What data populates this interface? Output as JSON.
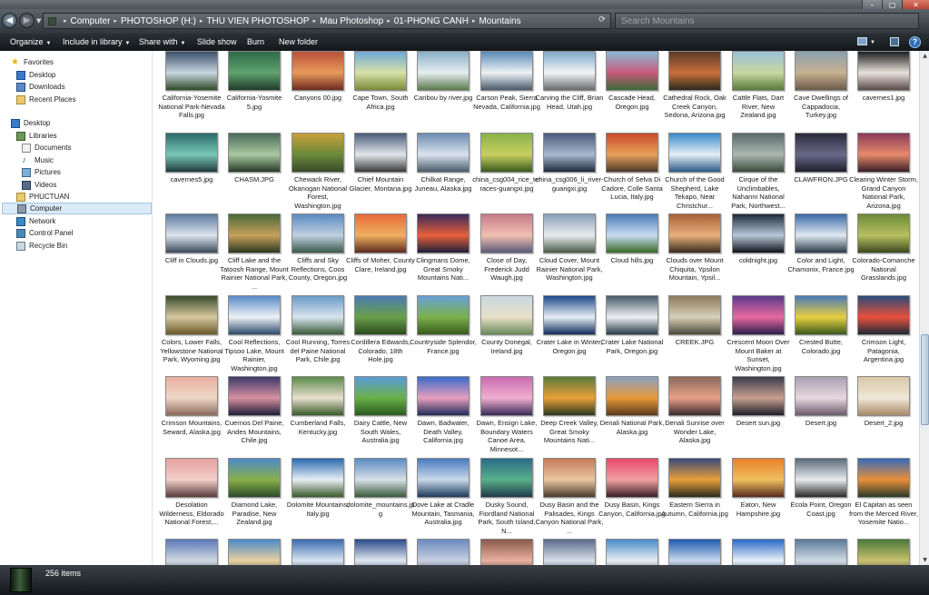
{
  "window": {
    "controls": [
      "–",
      "▢",
      "✕"
    ]
  },
  "address": {
    "crumbs": [
      "Computer",
      "PHOTOSHOP (H:)",
      "THU VIEN PHOTOSHOP",
      "Mau Photoshop",
      "01-PHONG CANH",
      "Mountains"
    ],
    "separator": "▸",
    "search_placeholder": "Search Mountains"
  },
  "toolbar": {
    "organize": "Organize",
    "include": "Include in library",
    "share": "Share with",
    "slideshow": "Slide show",
    "burn": "Burn",
    "newfolder": "New folder",
    "help": "?"
  },
  "nav": {
    "favorites": "Favorites",
    "desktop_fav": "Desktop",
    "downloads": "Downloads",
    "recent": "Recent Places",
    "desktop": "Desktop",
    "libraries": "Libraries",
    "documents": "Documents",
    "music": "Music",
    "pictures": "Pictures",
    "videos": "Videos",
    "user": "PHUCTUAN",
    "computer": "Computer",
    "network": "Network",
    "control_panel": "Control Panel",
    "recycle": "Recycle Bin"
  },
  "files": [
    {
      "name": "California-Yosemite National Park-Nevada Falls.jpg",
      "c1": "#3a4f6b",
      "c2": "#c8d6e0",
      "c3": "#2f4a2a"
    },
    {
      "name": "California-Yosmite 5.jpg",
      "c1": "#2f6b4a",
      "c2": "#5fa26e",
      "c3": "#1f3d2a"
    },
    {
      "name": "Canyons 00.jpg",
      "c1": "#b8523a",
      "c2": "#e89a5a",
      "c3": "#6b2a1e"
    },
    {
      "name": "Cape Town, South Africa.jpg",
      "c1": "#6ea8d6",
      "c2": "#d8e2a8",
      "c3": "#7a8a3a"
    },
    {
      "name": "Caribou by river.jpg",
      "c1": "#8ab0c8",
      "c2": "#e6eef2",
      "c3": "#5a7a4a"
    },
    {
      "name": "Carson Peak, Sierra Nevada, California.jpg",
      "c1": "#5a8ab8",
      "c2": "#eef2f5",
      "c3": "#4a5a6a"
    },
    {
      "name": "Carving the Cliff, Brian Head, Utah.jpg",
      "c1": "#7fa8c8",
      "c2": "#f2f4f6",
      "c3": "#6a6a6a"
    },
    {
      "name": "Cascade Head, Oregon.jpg",
      "c1": "#8ab8d8",
      "c2": "#c85a7a",
      "c3": "#3a6a3a"
    },
    {
      "name": "Cathedral Rock, Oak Creek Canyon, Sedona, Arizona.jpg",
      "c1": "#5a3a2a",
      "c2": "#c8703a",
      "c3": "#2a2a1e"
    },
    {
      "name": "Cattle Flats, Dart River, New Zealand.jpg",
      "c1": "#9ac0d8",
      "c2": "#c8d8a0",
      "c3": "#5a7a3a"
    },
    {
      "name": "Cave Dwellings of Cappadocia, Turkey.jpg",
      "c1": "#8aa0b0",
      "c2": "#c8b090",
      "c3": "#6a5a4a"
    },
    {
      "name": "cavernes1.jpg",
      "c1": "#1e1e1e",
      "c2": "#e8e2dc",
      "c3": "#5a4a4a"
    },
    {
      "name": "cavernes5.jpg",
      "c1": "#2a6a6a",
      "c2": "#7ac8b8",
      "c3": "#1e3a3a"
    },
    {
      "name": "CHASM.JPG",
      "c1": "#4a6a5a",
      "c2": "#a8c8a0",
      "c3": "#2a3a2a"
    },
    {
      "name": "Chewack River, Okanogan National Forest, Washington.jpg",
      "c1": "#c8a03a",
      "c2": "#6a8a3a",
      "c3": "#3a4a2a"
    },
    {
      "name": "Chief Mountain Glacier, Montana.jpg",
      "c1": "#4a5a7a",
      "c2": "#e2e6ea",
      "c3": "#3a3a3a"
    },
    {
      "name": "Chilkat Range, Juneau, Alaska.jpg",
      "c1": "#6a8ab0",
      "c2": "#dae4ee",
      "c3": "#4a5a6a"
    },
    {
      "name": "china_csg004_rice_terraces-guangxi.jpg",
      "c1": "#8ab04a",
      "c2": "#c8d060",
      "c3": "#3a5a1e"
    },
    {
      "name": "china_csg006_li_river-guangxi.jpg",
      "c1": "#4a5a7a",
      "c2": "#a8b8d0",
      "c3": "#1e2a3a"
    },
    {
      "name": "Church of Selva Di Cadore, Colle Santa Lucia, Italy.jpg",
      "c1": "#c84a2a",
      "c2": "#e8a05a",
      "c3": "#4a3a2a"
    },
    {
      "name": "Church of the Good Shepherd, Lake Tekapo, Near Christchur...",
      "c1": "#3a8ac8",
      "c2": "#e6eef4",
      "c3": "#2a5a8a"
    },
    {
      "name": "Cirque of the Unclimbables, Nahanni National Park, Northwest...",
      "c1": "#5a6a6a",
      "c2": "#aab8b0",
      "c3": "#3a4a3a"
    },
    {
      "name": "CLAWFRON.JPG",
      "c1": "#2a2a3a",
      "c2": "#6a6a8a",
      "c3": "#1e1e2a"
    },
    {
      "name": "Clearing Winter Storm, Grand Canyon National Park, Arizona.jpg",
      "c1": "#8a3a5a",
      "c2": "#e88a6a",
      "c3": "#3a1e2a"
    },
    {
      "name": "Cliff in Clouds.jpg",
      "c1": "#5a7aa0",
      "c2": "#dce4ec",
      "c3": "#3a4a5a"
    },
    {
      "name": "Cliff Lake and the Tatoosh Range, Mount Rainier National Park, ...",
      "c1": "#4a6a3a",
      "c2": "#c8a05a",
      "c3": "#2a3a1e"
    },
    {
      "name": "Cliffs and Sky Reflections, Coos County, Oregon.jpg",
      "c1": "#5a8ac0",
      "c2": "#c0d0e0",
      "c3": "#3a5a4a"
    },
    {
      "name": "Cliffs of Moher, County Clare, Ireland.jpg",
      "c1": "#e86a3a",
      "c2": "#f0b060",
      "c3": "#5a2a1e"
    },
    {
      "name": "Clingmans Dome, Great Smoky Mountains Nati...",
      "c1": "#3a2a5a",
      "c2": "#e8603a",
      "c3": "#1e1e3a"
    },
    {
      "name": "Close of Day, Frederick Judd Waugh.jpg",
      "c1": "#c87a8a",
      "c2": "#f0c0b0",
      "c3": "#5a5a7a"
    },
    {
      "name": "Cloud Cover, Mount Rainier National Park, Washington.jpg",
      "c1": "#8aa0b8",
      "c2": "#e8ecef",
      "c3": "#4a5a4a"
    },
    {
      "name": "Cloud hills.jpg",
      "c1": "#4a7ab8",
      "c2": "#c8dcf0",
      "c3": "#3a6a2a"
    },
    {
      "name": "Clouds over Mount Chiquita, Ypsilon Mountain, Ypsil...",
      "c1": "#a8603a",
      "c2": "#e8b07a",
      "c3": "#3a2a1e"
    },
    {
      "name": "coldnight.jpg",
      "c1": "#1e2a3a",
      "c2": "#b8c8d8",
      "c3": "#0e1218"
    },
    {
      "name": "Color and Light, Chamonix, France.jpg",
      "c1": "#3a6aa8",
      "c2": "#e0e8f0",
      "c3": "#2a3a4a"
    },
    {
      "name": "Colorado-Comanche National Grasslands.jpg",
      "c1": "#6a8a3a",
      "c2": "#b8c060",
      "c3": "#3a4a1e"
    },
    {
      "name": "Colors, Lower Falls, Yellowstone National Park, Wyoming.jpg",
      "c1": "#3a4a2a",
      "c2": "#d8c8a0",
      "c3": "#6a5a2a"
    },
    {
      "name": "Cool Reflections, Tipsoo Lake, Mount Rainier, Washington.jpg",
      "c1": "#5a8ac8",
      "c2": "#eef2f6",
      "c3": "#2a4a6a"
    },
    {
      "name": "Cool Running, Torres del Paine National Park, Chile.jpg",
      "c1": "#6a9ac8",
      "c2": "#d8e4ee",
      "c3": "#3a5a3a"
    },
    {
      "name": "Cordillera Edwards, Colorado, 18th Hole.jpg",
      "c1": "#4a7ab0",
      "c2": "#6aa04a",
      "c3": "#2a4a1e"
    },
    {
      "name": "Countryside Splendor, France.jpg",
      "c1": "#6aa0d8",
      "c2": "#7ab04a",
      "c3": "#3a5a1e"
    },
    {
      "name": "County Donegal, Ireland.jpg",
      "c1": "#c8d8e0",
      "c2": "#e8e0c8",
      "c3": "#6a8a5a"
    },
    {
      "name": "Crater Lake in Winter, Oregon.jpg",
      "c1": "#1e4a8a",
      "c2": "#e8eef4",
      "c3": "#0e2a5a"
    },
    {
      "name": "Crater Lake National Park, Oregon.jpg",
      "c1": "#4a5a6a",
      "c2": "#eef0f2",
      "c3": "#2a3a4a"
    },
    {
      "name": "CREEK.JPG",
      "c1": "#8a7a5a",
      "c2": "#d8d0b8",
      "c3": "#4a4a3a"
    },
    {
      "name": "Crescent Moon Over Mount Baker at Sunset, Washington.jpg",
      "c1": "#5a3a8a",
      "c2": "#e86aa0",
      "c3": "#2a1e4a"
    },
    {
      "name": "Crested Butte, Colorado.jpg",
      "c1": "#4a7ab8",
      "c2": "#e8d040",
      "c3": "#3a5a1e"
    },
    {
      "name": "Crimson Light, Patagonia, Argentina.jpg",
      "c1": "#2a4a7a",
      "c2": "#e8503a",
      "c3": "#1e2a3a"
    },
    {
      "name": "Crimson Mountains, Seward, Alaska.jpg",
      "c1": "#e8b0a0",
      "c2": "#f0d8c8",
      "c3": "#8a6a5a"
    },
    {
      "name": "Cuernos Del Paine, Andes Mountains, Chile.jpg",
      "c1": "#3a3a6a",
      "c2": "#d890a0",
      "c3": "#1e1e3a"
    },
    {
      "name": "Cumberland Falls, Kentucky.jpg",
      "c1": "#5a8a4a",
      "c2": "#e8e0d0",
      "c3": "#3a5a2a"
    },
    {
      "name": "Dairy Cattle, New South Wales, Australia.jpg",
      "c1": "#5a9ad8",
      "c2": "#6ab04a",
      "c3": "#2a5a1e"
    },
    {
      "name": "Dawn, Badwater, Death Valley, California.jpg",
      "c1": "#3a6ac8",
      "c2": "#e8a0c0",
      "c3": "#1e2a5a"
    },
    {
      "name": "Dawn, Ensign Lake, Boundary Waters Canoe Area, Minnesot...",
      "c1": "#c86ab0",
      "c2": "#f0b0d0",
      "c3": "#3a2a5a"
    },
    {
      "name": "Deep Creek Valley, Great Smoky Mountains Nati...",
      "c1": "#5a7a3a",
      "c2": "#e8a03a",
      "c3": "#2a3a1e"
    },
    {
      "name": "Denali National Park, Alaska.jpg",
      "c1": "#8aa0c0",
      "c2": "#e89a3a",
      "c3": "#5a3a1e"
    },
    {
      "name": "Denali Sunrise over Wonder Lake, Alaska.jpg",
      "c1": "#8a6a5a",
      "c2": "#e8a08a",
      "c3": "#3a2a2a"
    },
    {
      "name": "Desert sun.jpg",
      "c1": "#3a3a4a",
      "c2": "#c8a090",
      "c3": "#1e1e2a"
    },
    {
      "name": "Desert.jpg",
      "c1": "#a8a0b0",
      "c2": "#e8d8e0",
      "c3": "#6a5a6a"
    },
    {
      "name": "Desert_2.jpg",
      "c1": "#d8c8a8",
      "c2": "#f0e8d8",
      "c3": "#a88a6a"
    },
    {
      "name": "Desolation Wilderness, Eldorado National Forest,...",
      "c1": "#e8a0a0",
      "c2": "#f0d0c8",
      "c3": "#5a3a3a"
    },
    {
      "name": "Diamond Lake, Paradise, New Zealand.jpg",
      "c1": "#4a8ac8",
      "c2": "#8ab04a",
      "c3": "#2a4a2a"
    },
    {
      "name": "Dolomite Mountains, Italy.jpg",
      "c1": "#2a6ab0",
      "c2": "#e8eef4",
      "c3": "#3a5a2a"
    },
    {
      "name": "dolomite_mountains.jpg",
      "c1": "#5a8ac0",
      "c2": "#d8e0e8",
      "c3": "#3a5a3a"
    },
    {
      "name": "Dove Lake at Cradle Mountain, Tasmania, Australia.jpg",
      "c1": "#4a7ac0",
      "c2": "#c8d8e8",
      "c3": "#1e3a5a"
    },
    {
      "name": "Dusky Sound, Fiordland National Park, South Island, N...",
      "c1": "#2a6a8a",
      "c2": "#5ab08a",
      "c3": "#1e3a4a"
    },
    {
      "name": "Dusy Basin and the Palisades, Kings Canyon National Park, ...",
      "c1": "#c87a5a",
      "c2": "#e8c8a0",
      "c3": "#4a3a2a"
    },
    {
      "name": "Dusy Basin, Kings Canyon, California.jpg",
      "c1": "#e84a6a",
      "c2": "#f0a0a0",
      "c3": "#3a1e2a"
    },
    {
      "name": "Eastern Sierra in Autumn, California.jpg",
      "c1": "#3a4a7a",
      "c2": "#e8a03a",
      "c3": "#2a2a1e"
    },
    {
      "name": "Eaton, New Hampshire.jpg",
      "c1": "#e8802a",
      "c2": "#f0c060",
      "c3": "#5a2a1e"
    },
    {
      "name": "Ecola Point, Oregon Coast.jpg",
      "c1": "#5a6a7a",
      "c2": "#e8eaec",
      "c3": "#2a2a2a"
    },
    {
      "name": "El Capitan as seen from the Merced River, Yosemite Natio...",
      "c1": "#3a6ab8",
      "c2": "#e8903a",
      "c3": "#2a3a2a"
    },
    {
      "name": "",
      "c1": "#5a7ab8",
      "c2": "#d0d8e0",
      "c3": "#3a4a5a"
    },
    {
      "name": "",
      "c1": "#4a8ac8",
      "c2": "#e8d0a0",
      "c3": "#2a4a3a"
    },
    {
      "name": "",
      "c1": "#3a6ab0",
      "c2": "#d8e4f0",
      "c3": "#1e3a5a"
    },
    {
      "name": "",
      "c1": "#2a4a8a",
      "c2": "#e0e8f0",
      "c3": "#1e2a4a"
    },
    {
      "name": "",
      "c1": "#6a8ac0",
      "c2": "#c8d0e0",
      "c3": "#3a3a5a"
    },
    {
      "name": "",
      "c1": "#8a5a4a",
      "c2": "#e8b0a0",
      "c3": "#3a2a2a"
    },
    {
      "name": "",
      "c1": "#5a6a8a",
      "c2": "#d8e0e8",
      "c3": "#2a3a4a"
    },
    {
      "name": "",
      "c1": "#4a8ac8",
      "c2": "#e8eef4",
      "c3": "#3a4a5a"
    },
    {
      "name": "",
      "c1": "#1e5ab0",
      "c2": "#c8d8ec",
      "c3": "#1e2a4a"
    },
    {
      "name": "",
      "c1": "#2a6ac8",
      "c2": "#e8f0f8",
      "c3": "#1e3a6a"
    },
    {
      "name": "",
      "c1": "#5a7a9a",
      "c2": "#d0dae4",
      "c3": "#3a4a5a"
    },
    {
      "name": "",
      "c1": "#4a7a3a",
      "c2": "#c8c070",
      "c3": "#2a3a1e"
    }
  ],
  "status": {
    "count": "256 items"
  }
}
